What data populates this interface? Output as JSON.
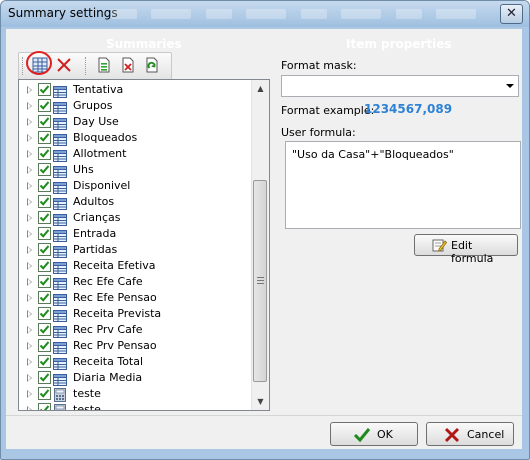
{
  "window": {
    "title": "Summary settings",
    "close_glyph": "✕"
  },
  "left_panel": {
    "header": "Summaries",
    "toolbar": [
      {
        "name": "add-summary-button",
        "icon": "table-add-icon"
      },
      {
        "name": "delete-button",
        "icon": "red-x-icon"
      },
      {
        "name": "new-document-button",
        "icon": "green-document-icon"
      },
      {
        "name": "remove-document-button",
        "icon": "document-red-x-icon"
      },
      {
        "name": "refresh-button",
        "icon": "green-refresh-icon"
      }
    ],
    "items": [
      {
        "label": "Tentativa",
        "checked": true,
        "icon": "table-icon"
      },
      {
        "label": "Grupos",
        "checked": true,
        "icon": "table-icon"
      },
      {
        "label": "Day Use",
        "checked": true,
        "icon": "table-icon"
      },
      {
        "label": "Bloqueados",
        "checked": true,
        "icon": "table-icon"
      },
      {
        "label": "Allotment",
        "checked": true,
        "icon": "table-icon"
      },
      {
        "label": "Uhs",
        "checked": true,
        "icon": "table-icon"
      },
      {
        "label": "Disponivel",
        "checked": true,
        "icon": "table-icon"
      },
      {
        "label": "Adultos",
        "checked": true,
        "icon": "table-icon"
      },
      {
        "label": "Crianças",
        "checked": true,
        "icon": "table-icon"
      },
      {
        "label": "Entrada",
        "checked": true,
        "icon": "table-icon"
      },
      {
        "label": "Partidas",
        "checked": true,
        "icon": "table-icon"
      },
      {
        "label": "Receita Efetiva",
        "checked": true,
        "icon": "table-icon"
      },
      {
        "label": "Rec Efe Cafe",
        "checked": true,
        "icon": "table-icon"
      },
      {
        "label": "Rec Efe Pensao",
        "checked": true,
        "icon": "table-icon"
      },
      {
        "label": "Receita Prevista",
        "checked": true,
        "icon": "table-icon"
      },
      {
        "label": "Rec Prv Cafe",
        "checked": true,
        "icon": "table-icon"
      },
      {
        "label": "Rec Prv Pensao",
        "checked": true,
        "icon": "table-icon"
      },
      {
        "label": "Receita Total",
        "checked": true,
        "icon": "table-icon"
      },
      {
        "label": "Diaria Media",
        "checked": true,
        "icon": "table-icon"
      },
      {
        "label": "teste",
        "checked": true,
        "icon": "calculator-icon"
      },
      {
        "label": "teste",
        "checked": true,
        "icon": "calculator-icon"
      }
    ]
  },
  "right_panel": {
    "header": "Item properties",
    "format_mask_label": "Format mask:",
    "format_mask_value": "",
    "format_example_label": "Format example:",
    "format_example_value": "1234567,089",
    "user_formula_label": "User formula:",
    "user_formula_value": "\"Uso da Casa\"+\"Bloqueados\"",
    "edit_formula_label": "Edit formula"
  },
  "footer": {
    "ok_label": "OK",
    "cancel_label": "Cancel"
  },
  "colors": {
    "accent_blue": "#2e82d6",
    "check_green": "#1e8a1e",
    "delete_red": "#d02020",
    "focus_circle": "#e02020"
  }
}
